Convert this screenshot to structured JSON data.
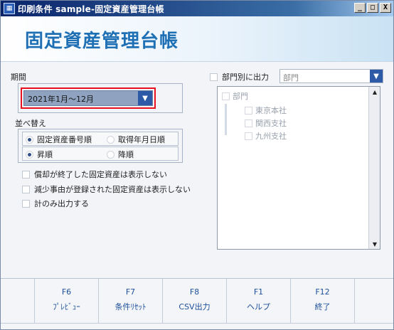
{
  "window": {
    "title": "印刷条件 sample-固定資産管理台帳",
    "min_label": "_",
    "max_label": "□",
    "close_label": "X"
  },
  "header": {
    "title": "固定資産管理台帳"
  },
  "period": {
    "label": "期間",
    "value": "2021年1月～12月"
  },
  "sort": {
    "label": "並べ替え",
    "key_options": [
      {
        "label": "固定資産番号順",
        "selected": true
      },
      {
        "label": "取得年月日順",
        "selected": false
      }
    ],
    "order_options": [
      {
        "label": "昇順",
        "selected": true
      },
      {
        "label": "降順",
        "selected": false
      }
    ]
  },
  "options": [
    {
      "label": "償却が終了した固定資産は表示しない",
      "checked": false
    },
    {
      "label": "減少事由が登録された固定資産は表示しない",
      "checked": false
    },
    {
      "label": "計のみ出力する",
      "checked": false
    }
  ],
  "dept_output": {
    "checkbox_label": "部門別に出力",
    "combo_value": "部門",
    "tree_root": "部門",
    "tree_children": [
      "東京本社",
      "関西支社",
      "九州支社"
    ]
  },
  "footer": {
    "buttons": [
      {
        "key": "F6",
        "label": "ﾌﾟﾚﾋﾞｭｰ"
      },
      {
        "key": "F7",
        "label": "条件ﾘｾｯﾄ"
      },
      {
        "key": "F8",
        "label": "CSV出力"
      },
      {
        "key": "F1",
        "label": "ヘルプ"
      },
      {
        "key": "F12",
        "label": "終了"
      }
    ]
  },
  "colors": {
    "title_text": "#1f6fb5",
    "highlight_border": "#e8101e",
    "combo_button": "#2d5aa6"
  }
}
